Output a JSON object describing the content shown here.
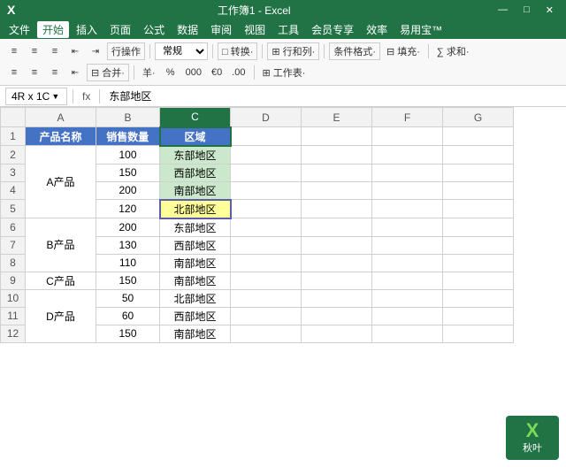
{
  "titleBar": {
    "title": "工作簿1 - Excel",
    "minimize": "—",
    "maximize": "□",
    "close": "✕"
  },
  "menuBar": {
    "items": [
      "文件",
      "开始",
      "插入",
      "页面",
      "公式",
      "数据",
      "审阅",
      "视图",
      "工具",
      "会员专享",
      "效率",
      "易用宝™"
    ],
    "activeIndex": 0,
    "highlightIndex": 1
  },
  "toolbar": {
    "row1": {
      "alignLeft": "≡",
      "alignCenter": "≡",
      "alignRight": "≡",
      "indent": "⇥",
      "outdent": "⇤",
      "wrap": "行操作",
      "viewSelect": "常规",
      "transformLabel": "□ 转换·",
      "mergeLabel": "⊞ 行和列·",
      "conditionalLabel": "条件格式·",
      "fillLabel": "⊟ 填充·",
      "sumLabel": "∑ 求和·"
    },
    "row2": {
      "b1": "≡",
      "b2": "≡",
      "b3": "≡",
      "b4": "⇤",
      "b5": "⊟ 合并·",
      "pct": "羊·",
      "percent": "%",
      "comma": "000",
      "dec1": "€0",
      "dec2": "00",
      "workLabel": "⊞ 工作表·"
    }
  },
  "formulaBar": {
    "cellRef": "4R x 1C",
    "fx": "fx",
    "formula": "东部地区"
  },
  "columns": [
    "A",
    "B",
    "C",
    "D",
    "E",
    "F",
    "G"
  ],
  "rows": [
    {
      "num": 1,
      "a": "产品名称",
      "b": "销售数量",
      "c": "区域",
      "isHeader": true
    },
    {
      "num": 2,
      "a": "",
      "b": "100",
      "c": "东部地区",
      "aspan": true
    },
    {
      "num": 3,
      "a": "A产品",
      "b": "150",
      "c": "西部地区",
      "aspan": false
    },
    {
      "num": 4,
      "a": "",
      "b": "200",
      "c": "南部地区",
      "aspan": true
    },
    {
      "num": 5,
      "a": "",
      "b": "120",
      "c": "北部地区",
      "aspan": true,
      "activeEdit": true
    },
    {
      "num": 6,
      "a": "",
      "b": "200",
      "c": "东部地区",
      "aspan": true
    },
    {
      "num": 7,
      "a": "B产品",
      "b": "130",
      "c": "西部地区"
    },
    {
      "num": 8,
      "a": "",
      "b": "110",
      "c": "南部地区",
      "aspan": true
    },
    {
      "num": 9,
      "a": "C产品",
      "b": "150",
      "c": "南部地区"
    },
    {
      "num": 10,
      "a": "",
      "b": "50",
      "c": "北部地区",
      "aspan": true
    },
    {
      "num": 11,
      "a": "D产品",
      "b": "60",
      "c": "西部地区"
    },
    {
      "num": 12,
      "a": "",
      "b": "150",
      "c": "南部地区",
      "aspan": true
    }
  ],
  "watermark": {
    "x": "X",
    "text": "秋叶"
  },
  "colors": {
    "headerBg": "#4472c4",
    "selectedBg": "#cce8cc",
    "activeEditBg": "#ffff99",
    "green": "#217346",
    "watermarkGreen": "#7ed957"
  }
}
